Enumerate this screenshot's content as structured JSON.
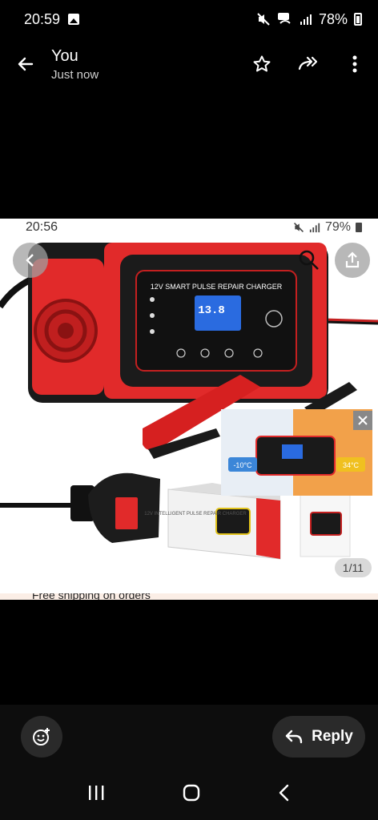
{
  "status_bar": {
    "time": "20:59",
    "battery": "78%"
  },
  "app_bar": {
    "sender": "You",
    "sent_time": "Just now"
  },
  "image": {
    "inner_status": {
      "time": "20:56",
      "battery": "79%"
    },
    "product_title": "12V SMART PULSE REPAIR CHARGER",
    "lcd_value": "13.8",
    "counter": "1/11",
    "footer_text": "Free shipping on orders",
    "box_text": "12V INTELLIGENT PULSE REPAIR CHARGER",
    "winter_temp": "-10°C",
    "summer_temp": "34°C"
  },
  "reply": {
    "label": "Reply"
  },
  "colors": {
    "accent_red": "#e8202a",
    "device_black": "#1a1a1a",
    "lcd_blue": "#2a6be0"
  },
  "icons": [
    "back-arrow-icon",
    "star-icon",
    "forward-icon",
    "more-vert-icon",
    "emoji-add-icon",
    "reply-arrow-icon",
    "nav-recents-icon",
    "nav-home-icon",
    "nav-back-icon"
  ]
}
